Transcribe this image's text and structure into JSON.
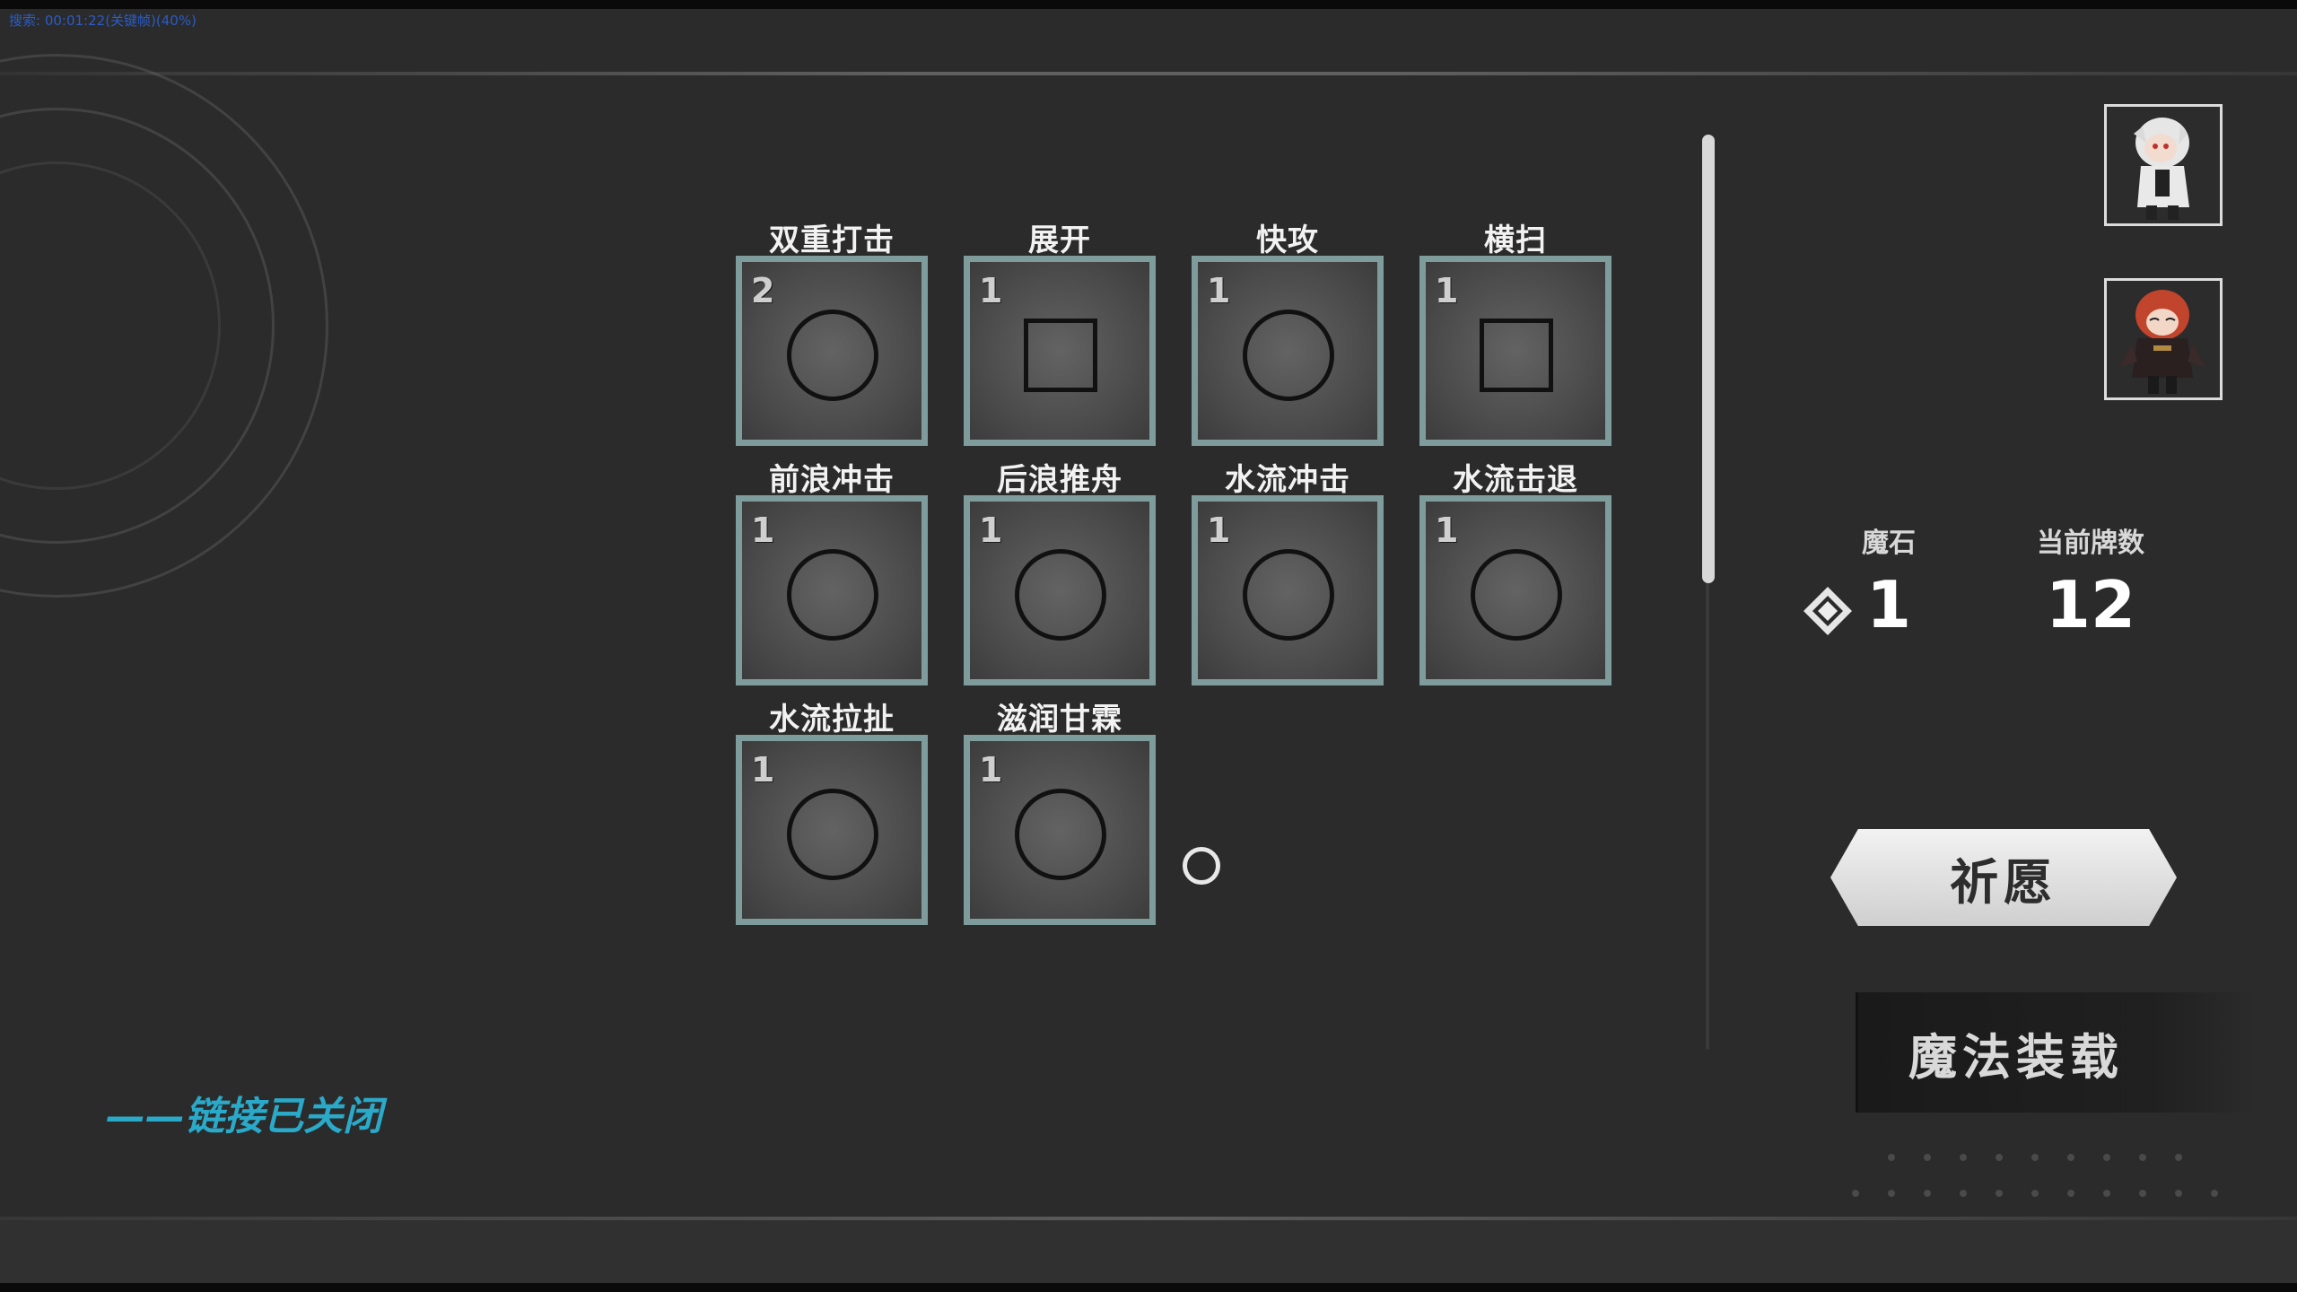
{
  "debug": {
    "text": "搜索: 00:01:22(关键帧)(40%)"
  },
  "cards": [
    {
      "label": "双重打击",
      "cost": "2",
      "shape": "circle-icon"
    },
    {
      "label": "展开",
      "cost": "1",
      "shape": "square-icon"
    },
    {
      "label": "快攻",
      "cost": "1",
      "shape": "circle-icon"
    },
    {
      "label": "横扫",
      "cost": "1",
      "shape": "square-icon"
    },
    {
      "label": "前浪冲击",
      "cost": "1",
      "shape": "circle-icon"
    },
    {
      "label": "后浪推舟",
      "cost": "1",
      "shape": "circle-icon"
    },
    {
      "label": "水流冲击",
      "cost": "1",
      "shape": "circle-icon"
    },
    {
      "label": "水流击退",
      "cost": "1",
      "shape": "circle-icon"
    },
    {
      "label": "水流拉扯",
      "cost": "1",
      "shape": "circle-icon"
    },
    {
      "label": "滋润甘霖",
      "cost": "1",
      "shape": "circle-icon"
    }
  ],
  "stats": {
    "magic_stone": {
      "label": "魔石",
      "value": "1"
    },
    "card_count": {
      "label": "当前牌数",
      "value": "12"
    }
  },
  "buttons": {
    "pray": "祈愿",
    "magic_load": "魔法装载"
  },
  "status": {
    "link_text": "——链接已关闭"
  },
  "colors": {
    "background": "#2b2b2b",
    "card_border": "#7e9c9c",
    "link_text": "#2aa9c9"
  }
}
